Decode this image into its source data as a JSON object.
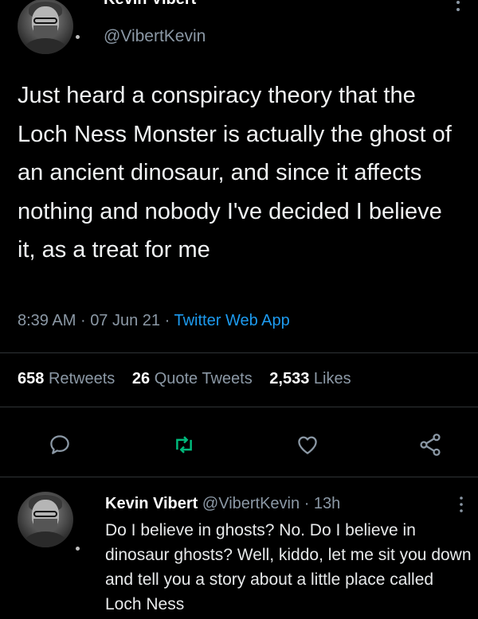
{
  "tweet": {
    "display_name": "Kevin Vibert",
    "handle": "@VibertKevin",
    "text": "Just heard a conspiracy theory that the Loch Ness Monster is actually the ghost of an ancient dinosaur, and since it affects nothing and nobody I've decided I believe it, as a treat for me",
    "time": "8:39 AM",
    "sep1": "·",
    "date": "07 Jun 21",
    "sep2": "·",
    "source": "Twitter Web App"
  },
  "stats": {
    "retweets_count": "658",
    "retweets_label": "Retweets",
    "quotes_count": "26",
    "quotes_label": "Quote Tweets",
    "likes_count": "2,533",
    "likes_label": "Likes"
  },
  "actions": [
    "reply-icon",
    "retweet-icon",
    "like-icon",
    "share-icon"
  ],
  "colors": {
    "background": "#000000",
    "text": "#e7e9ea",
    "muted": "#8b98a5",
    "link": "#1d9bf0",
    "retweet": "#00ba7c"
  },
  "reply": {
    "display_name": "Kevin Vibert",
    "handle": "@VibertKevin",
    "sep": "·",
    "age": "13h",
    "text": "Do I believe in ghosts? No. Do I believe in dinosaur ghosts? Well, kiddo, let me sit you down and tell you a story about a little place called Loch Ness"
  }
}
